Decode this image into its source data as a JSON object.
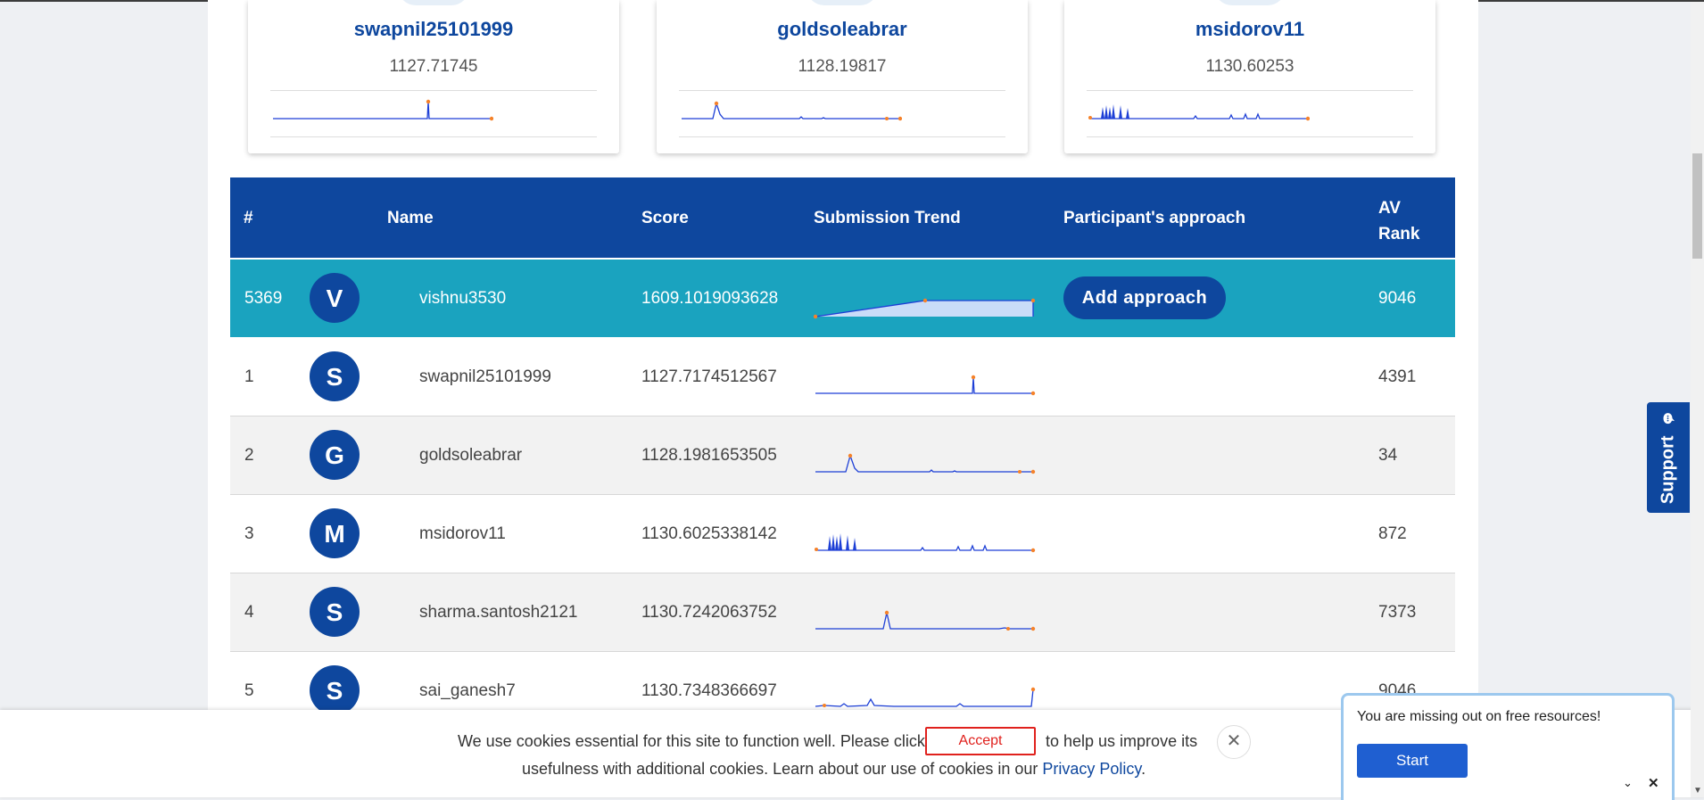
{
  "top_cards": [
    {
      "name": "swapnil25101999",
      "score": "1127.71745"
    },
    {
      "name": "goldsoleabrar",
      "score": "1128.19817"
    },
    {
      "name": "msidorov11",
      "score": "1130.60253"
    }
  ],
  "table": {
    "headers": {
      "rank": "#",
      "name": "Name",
      "score": "Score",
      "trend": "Submission Trend",
      "approach": "Participant's approach",
      "av_rank": "AV Rank"
    },
    "current_user": {
      "rank": "5369",
      "initial": "V",
      "name": "vishnu3530",
      "score": "1609.1019093628",
      "approach_button": "Add approach",
      "av_rank": "9046"
    },
    "rows": [
      {
        "rank": "1",
        "initial": "S",
        "name": "swapnil25101999",
        "score": "1127.7174512567",
        "av_rank": "4391"
      },
      {
        "rank": "2",
        "initial": "G",
        "name": "goldsoleabrar",
        "score": "1128.1981653505",
        "av_rank": "34"
      },
      {
        "rank": "3",
        "initial": "M",
        "name": "msidorov11",
        "score": "1130.6025338142",
        "av_rank": "872"
      },
      {
        "rank": "4",
        "initial": "S",
        "name": "sharma.santosh2121",
        "score": "1130.7242063752",
        "av_rank": "7373"
      },
      {
        "rank": "5",
        "initial": "S",
        "name": "sai_ganesh7",
        "score": "1130.7348366697",
        "av_rank": "9046"
      }
    ]
  },
  "cookie": {
    "text_before": "We use cookies essential for this site to function well. Please click",
    "accept_label": "Accept",
    "text_after": "to help us improve its",
    "line2": "usefulness with additional cookies. Learn about our use of cookies in our",
    "policy_link": "Privacy Policy",
    "period": ".",
    "close_glyph": "✕"
  },
  "resource_popup": {
    "message": "You are missing out on free resources!",
    "start_label": "Start",
    "collapse_glyph": "⌄",
    "close_glyph": "✕"
  },
  "support": {
    "label": "Support",
    "icon": "chat-bubble-icon"
  },
  "colors": {
    "primary": "#0e479e",
    "highlight_row": "#1aa3bf",
    "accept_border": "#e0211d",
    "start_button": "#1f5fd1",
    "sparkline": "#1d3fd6",
    "sparkline_dot": "#f5822a"
  }
}
